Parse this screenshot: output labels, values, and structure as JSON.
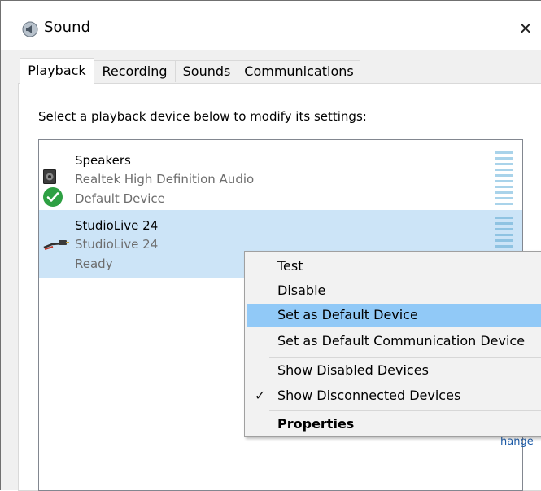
{
  "window": {
    "title": "Sound",
    "title_icon": "speaker-icon",
    "close_glyph": "✕"
  },
  "tabs": [
    {
      "label": "Playback",
      "active": true
    },
    {
      "label": "Recording",
      "active": false
    },
    {
      "label": "Sounds",
      "active": false
    },
    {
      "label": "Communications",
      "active": false
    }
  ],
  "playback": {
    "instruction": "Select a playback device below to modify its settings:",
    "devices": [
      {
        "name": "Speakers",
        "driver": "Realtek High Definition Audio",
        "status": "Default Device",
        "icon": "speaker-icon",
        "badge": "default-check-icon",
        "selected": false
      },
      {
        "name": "StudioLive 24",
        "driver": "StudioLive 24",
        "status": "Ready",
        "icon": "cable-icon",
        "selected": true
      }
    ],
    "partial_side_text": "hange"
  },
  "context_menu": {
    "items": [
      {
        "label": "Test",
        "highlighted": false,
        "checked": false,
        "bold": false
      },
      {
        "label": "Disable",
        "highlighted": false,
        "checked": false,
        "bold": false
      },
      {
        "label": "Set as Default Device",
        "highlighted": true,
        "checked": false,
        "bold": false
      },
      {
        "label": "Set as Default Communication Device",
        "highlighted": false,
        "checked": false,
        "bold": false
      },
      {
        "label": "Show Disabled Devices",
        "highlighted": false,
        "checked": false,
        "bold": false
      },
      {
        "label": "Show Disconnected Devices",
        "highlighted": false,
        "checked": true,
        "bold": false
      },
      {
        "label": "Properties",
        "highlighted": false,
        "checked": false,
        "bold": true
      }
    ],
    "check_glyph": "✓"
  },
  "colors": {
    "selection": "#cce4f7",
    "menu_highlight": "#91c9f7",
    "default_badge": "#2ea043"
  }
}
